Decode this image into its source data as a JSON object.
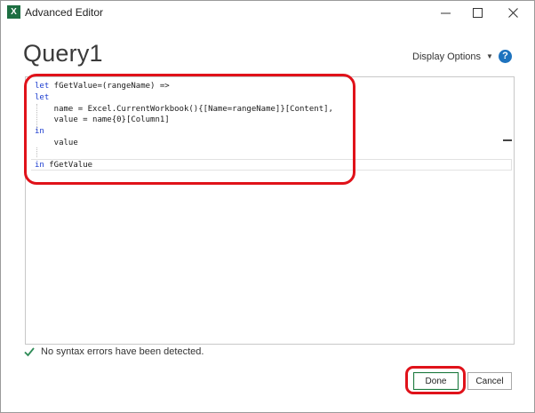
{
  "window": {
    "title": "Advanced Editor",
    "app_icon_glyph": "X",
    "app_icon_color": "#1d6f42",
    "controls": [
      "minimize-icon",
      "maximize-icon",
      "close-icon"
    ]
  },
  "header": {
    "query_title": "Query1",
    "display_options_label": "Display Options",
    "help_glyph": "?",
    "help_color": "#1e73be"
  },
  "editor": {
    "lines": [
      {
        "kw": "let",
        "text": " fGetValue=(rangeName) =>"
      },
      {
        "kw": "let",
        "text": ""
      },
      {
        "kw": "",
        "text": "    name = Excel.CurrentWorkbook(){[Name=rangeName]}[Content],"
      },
      {
        "kw": "",
        "text": "    value = name{0}[Column1]"
      },
      {
        "kw": "in",
        "text": ""
      },
      {
        "kw": "",
        "text": "    value"
      },
      {
        "kw": "",
        "text": ""
      },
      {
        "kw": "in",
        "text": " fGetValue"
      }
    ],
    "keyword_color": "#1b3ccf"
  },
  "status": {
    "message": "No syntax errors have been detected.",
    "icon": "check-icon",
    "icon_color": "#2e8b57"
  },
  "buttons": {
    "done_label": "Done",
    "cancel_label": "Cancel"
  },
  "annotations": {
    "highlight_color": "#e0121a"
  }
}
